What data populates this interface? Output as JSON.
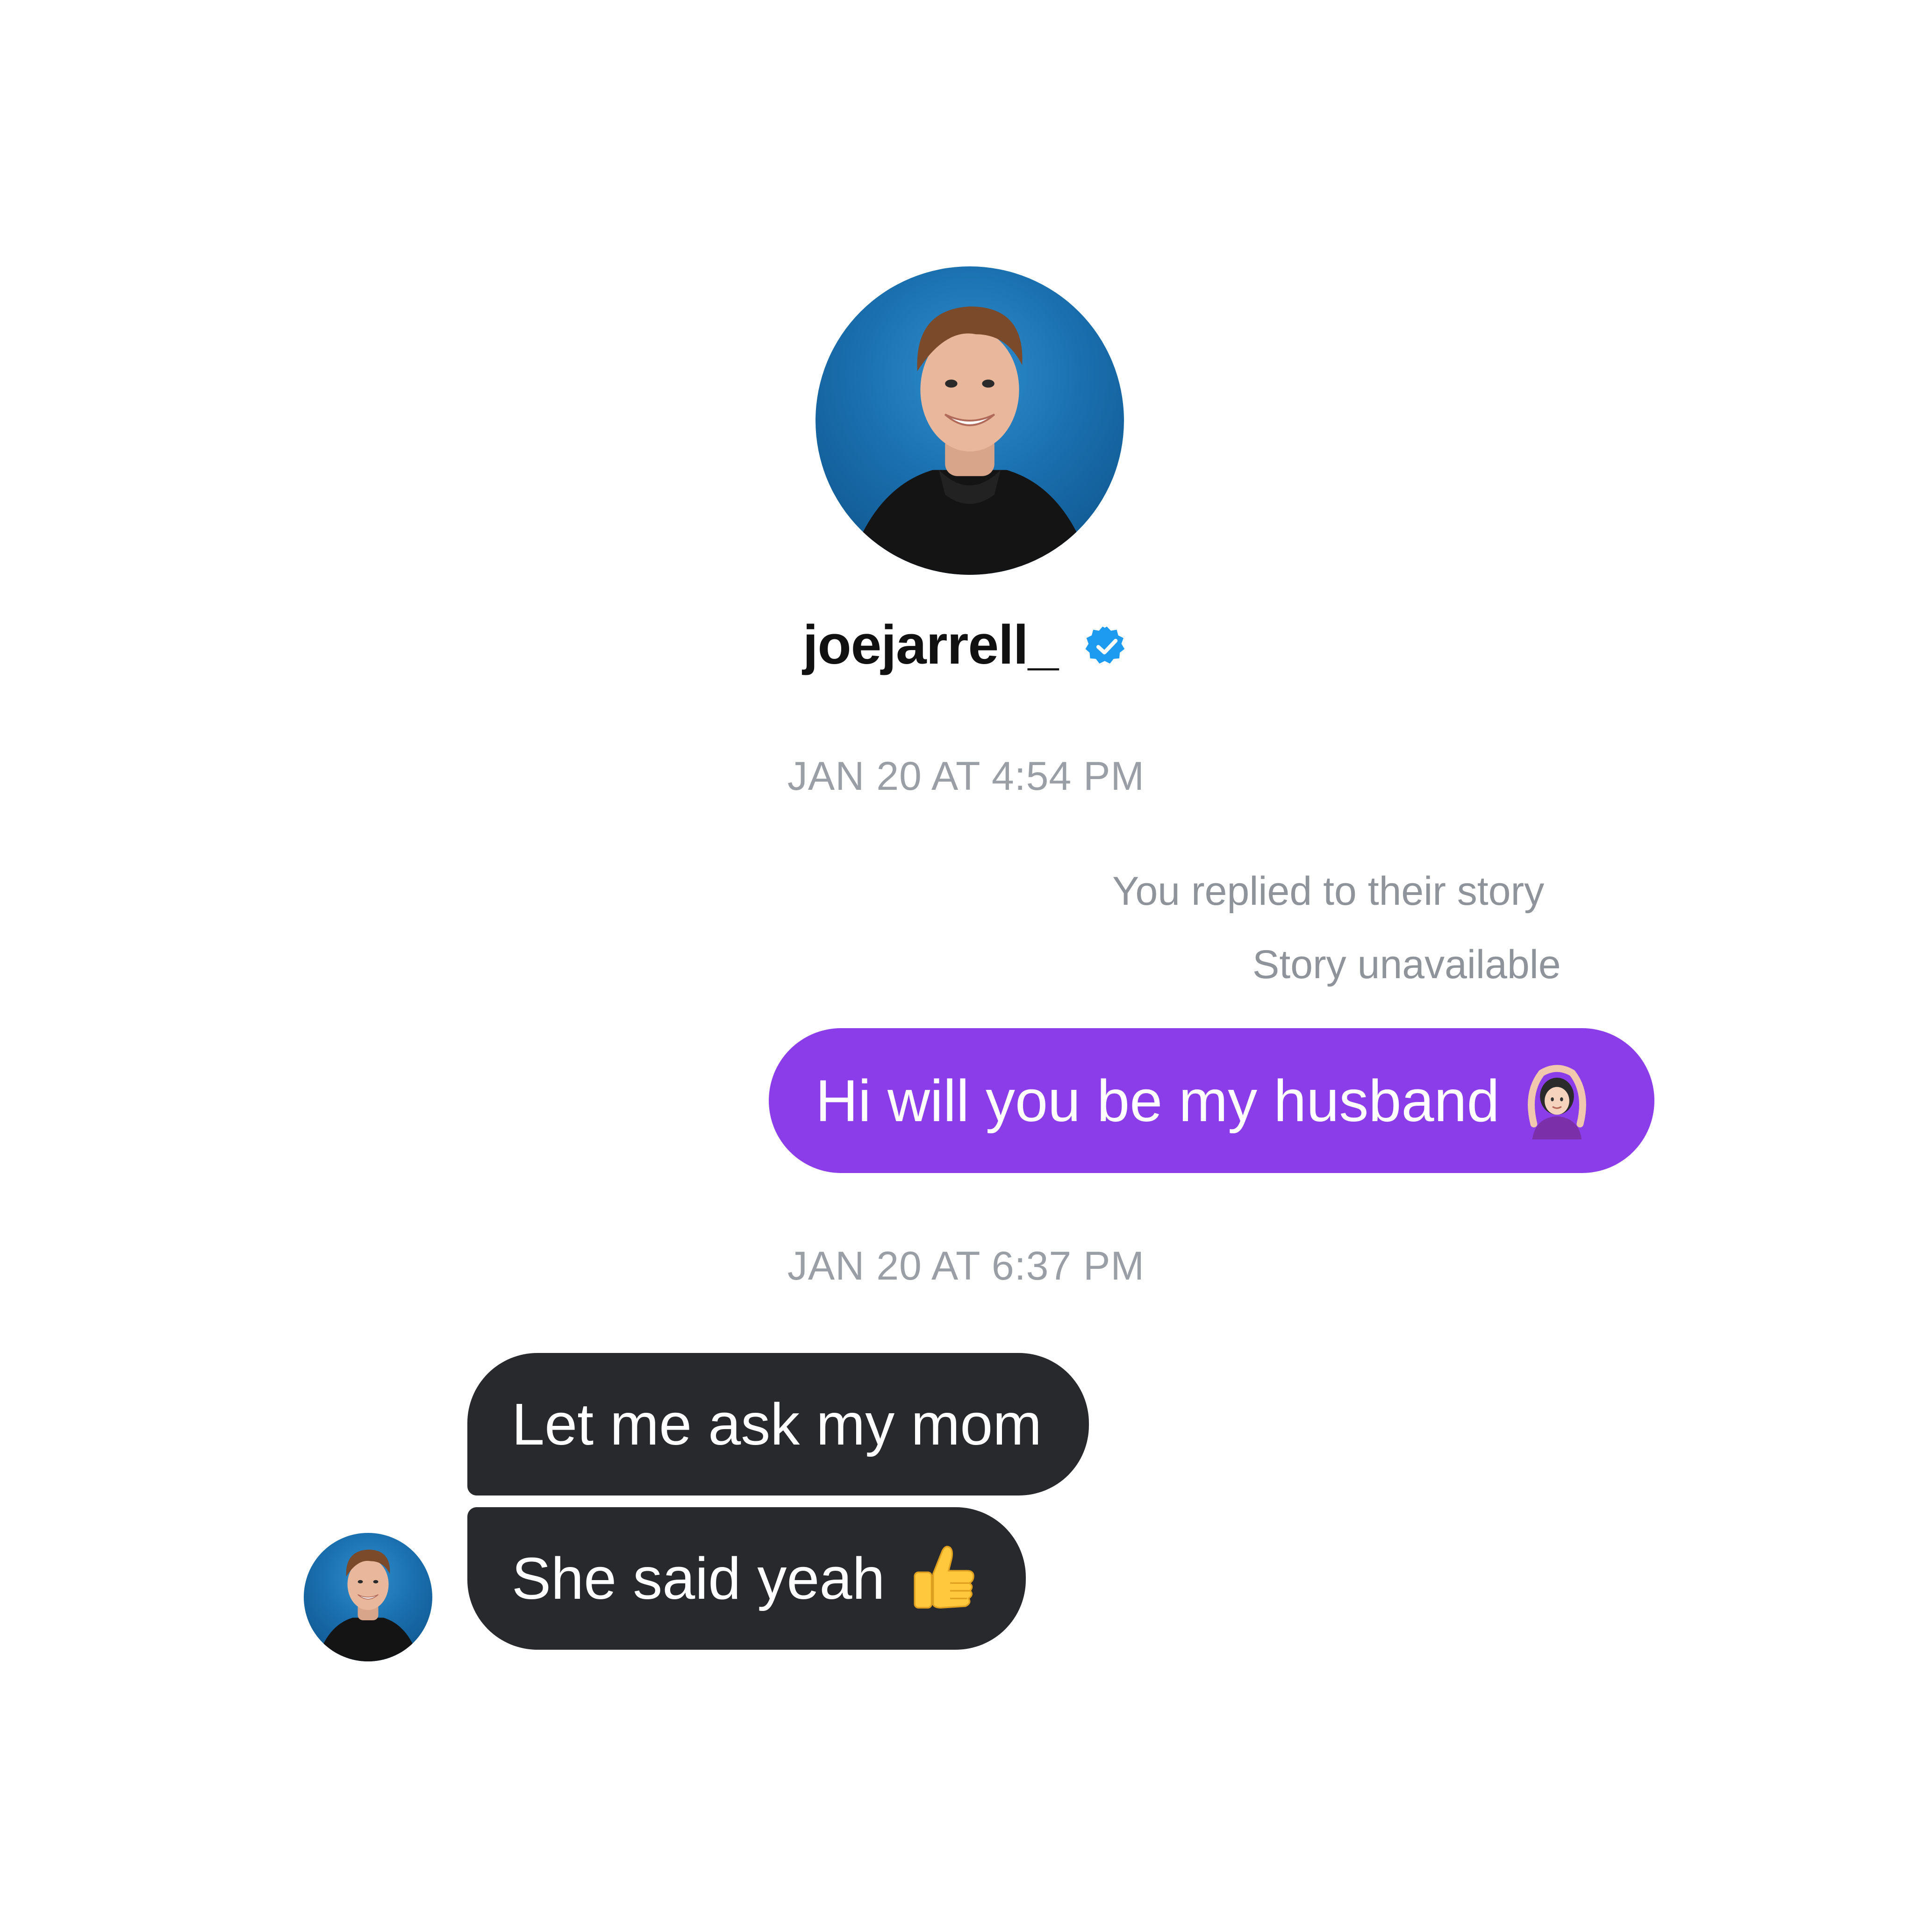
{
  "contact": {
    "username": "joejarrell_",
    "verified_icon": "verified-badge-icon",
    "verified_color": "#1d9bf0"
  },
  "thread": {
    "timestamp_1": "JAN 20 AT 4:54 PM",
    "story_reply_note": "You replied to their story",
    "story_unavailable_note": "Story unavailable",
    "outgoing_message": {
      "text": "Hi will you be my husband",
      "emoji_icon": "woman-gesturing-ok-emoji"
    },
    "timestamp_2": "JAN 20 AT 6:37 PM",
    "incoming_messages": [
      {
        "text": "Let me ask my mom"
      },
      {
        "text": "She said yeah",
        "emoji_icon": "thumbs-up-emoji"
      }
    ]
  },
  "colors": {
    "outgoing_bubble": "#8a3de8",
    "incoming_bubble": "#27292d",
    "timestamp_text": "#9a9fa6"
  }
}
